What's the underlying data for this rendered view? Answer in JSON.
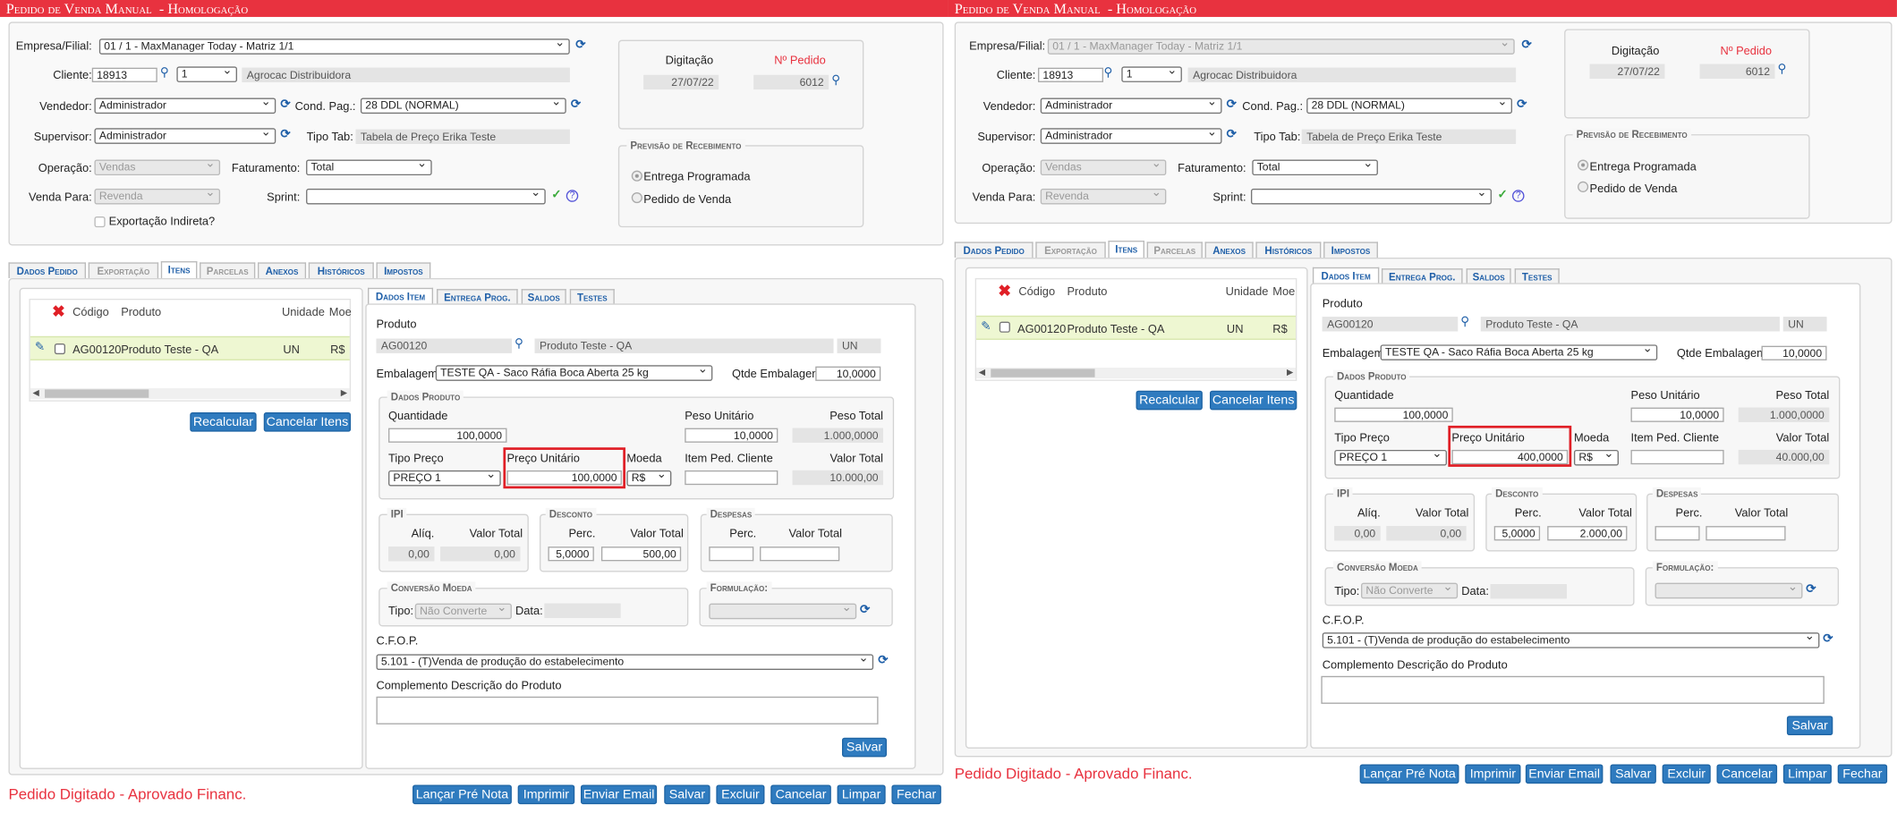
{
  "title": "Pedido de Venda Manual  - Homologação",
  "form": {
    "empresa_label": "Empresa/Filial:",
    "empresa_value": "01 / 1 - MaxManager Today - Matriz 1/1",
    "cliente_label": "Cliente:",
    "cliente_code": "18913",
    "cliente_seq": "1",
    "cliente_name": "Agrocac Distribuidora",
    "vendedor_label": "Vendedor:",
    "vendedor_value": "Administrador",
    "condpag_label": "Cond. Pag.:",
    "condpag_value": "28 DDL (NORMAL)",
    "supervisor_label": "Supervisor:",
    "supervisor_value": "Administrador",
    "tipotab_label": "Tipo Tab:",
    "tipotab_value": "Tabela de Preço Erika Teste",
    "operacao_label": "Operação:",
    "operacao_value": "Vendas",
    "faturamento_label": "Faturamento:",
    "faturamento_value": "Total",
    "vendapara_label": "Venda Para:",
    "vendapara_value": "Revenda",
    "sprint_label": "Sprint:",
    "sprint_value": "",
    "exportacao_label": "Exportação Indireta?"
  },
  "info": {
    "digitacao_label": "Digitação",
    "pedido_label": "Nº Pedido",
    "digitacao_value": "27/07/22",
    "pedido_value": "6012",
    "previsao_legend": "Previsão de Recebimento",
    "radio1": "Entrega Programada",
    "radio2": "Pedido de Venda"
  },
  "tabs": [
    "Dados Pedido",
    "Exportação",
    "Itens",
    "Parcelas",
    "Anexos",
    "Históricos",
    "Impostos"
  ],
  "grid": {
    "headers": [
      "Código",
      "Produto",
      "Unidade",
      "Moe"
    ],
    "row": {
      "codigo": "AG00120",
      "produto": "Produto Teste - QA",
      "unidade": "UN",
      "moeda": "R$"
    }
  },
  "grid_buttons": {
    "recalcular": "Recalcular",
    "cancelar": "Cancelar Itens"
  },
  "item_tabs": [
    "Dados Item",
    "Entrega Prog.",
    "Saldos",
    "Testes"
  ],
  "item": {
    "produto_label": "Produto",
    "produto_code": "AG00120",
    "produto_name": "Produto Teste - QA",
    "produto_un": "UN",
    "embalagem_label": "Embalagem",
    "embalagem_value": "TESTE QA - Saco Ráfia Boca Aberta 25 kg",
    "qtde_emb_label": "Qtde Embalagem",
    "qtde_emb_value": "10,0000",
    "dados_legend": "Dados Produto",
    "quantidade_label": "Quantidade",
    "quantidade_value": "100,0000",
    "peso_unit_label": "Peso Unitário",
    "peso_unit_value": "10,0000",
    "peso_total_label": "Peso Total",
    "peso_total_value": "1.000,0000",
    "tipo_preco_label": "Tipo Preço",
    "tipo_preco_value": "PREÇO 1",
    "preco_unit_label": "Preço Unitário",
    "moeda_label": "Moeda",
    "moeda_value": "R$",
    "item_ped_label": "Item Ped. Cliente",
    "item_ped_value": "",
    "valor_total_label": "Valor Total",
    "ipi_legend": "IPI",
    "aliq_label": "Alíq.",
    "valor_total2_label": "Valor Total",
    "ipi_aliq": "0,00",
    "ipi_valor": "0,00",
    "desconto_legend": "Desconto",
    "perc_label": "Perc.",
    "despesas_legend": "Despesas",
    "desp_perc": "",
    "desp_valor": "",
    "conversao_legend": "Conversão Moeda",
    "tipo_label": "Tipo:",
    "tipo_value": "Não Converte",
    "data_label": "Data:",
    "data_value": "",
    "formulacao_legend": "Formulação:",
    "cfop_label": "C.F.O.P.",
    "cfop_value": "5.101 - (T)Venda de produção do estabelecimento",
    "complemento_label": "Complemento Descrição do Produto",
    "salvar": "Salvar"
  },
  "left_values": {
    "preco_unit": "100,0000",
    "valor_total": "10.000,00",
    "desc_perc": "5,0000",
    "desc_valor": "500,00"
  },
  "right_values": {
    "preco_unit": "400,0000",
    "valor_total": "40.000,00",
    "desc_perc": "5,0000",
    "desc_valor": "2.000,00"
  },
  "status": "Pedido Digitado - Aprovado Financ.",
  "actions": [
    "Lançar Pré Nota",
    "Imprimir",
    "Enviar Email",
    "Salvar",
    "Excluir",
    "Cancelar",
    "Limpar",
    "Fechar"
  ],
  "colors": {
    "title_bar": "#e8323f",
    "button": "#2f7bbf",
    "highlight_row": "#eef7d2",
    "red_box": "#e01f26"
  }
}
